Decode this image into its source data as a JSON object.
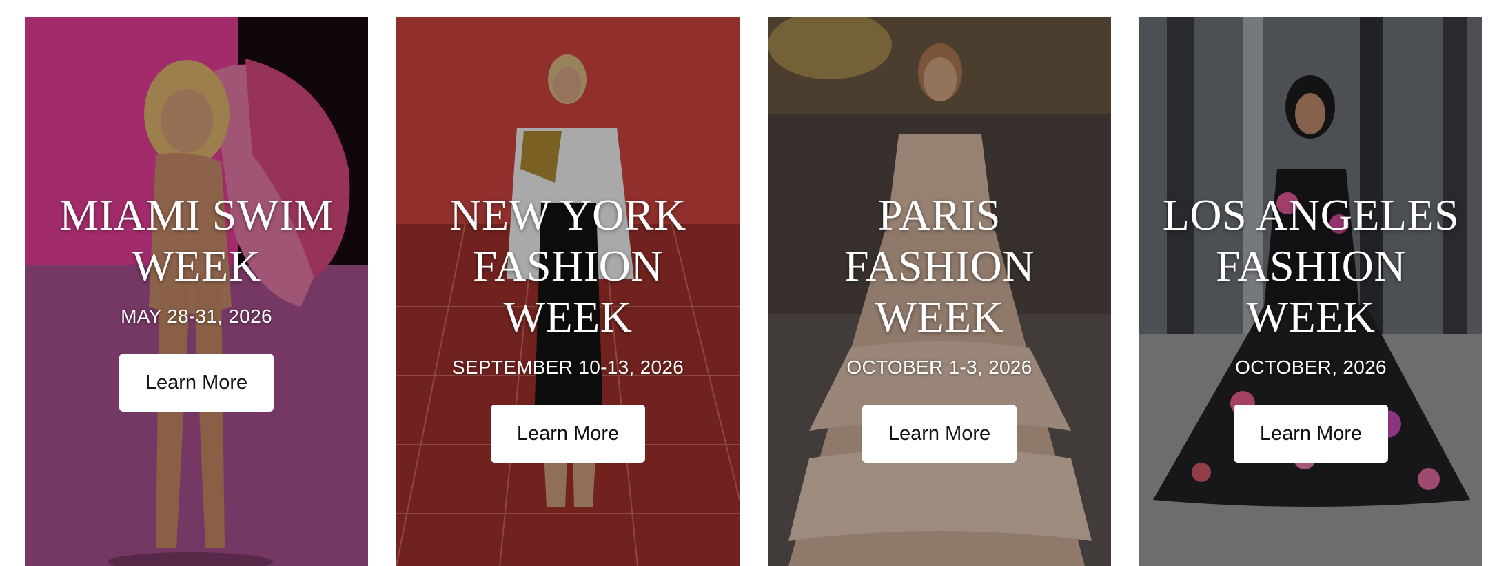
{
  "events": [
    {
      "title": "MIAMI SWIM WEEK",
      "date": "MAY 28-31, 2026",
      "cta_label": "Learn More",
      "photo_icon": "runway-model-photo",
      "accent": "#c0407f"
    },
    {
      "title": "NEW YORK FASHION WEEK",
      "date": "SEPTEMBER 10-13, 2026",
      "cta_label": "Learn More",
      "photo_icon": "runway-model-photo",
      "accent": "#b43a34"
    },
    {
      "title": "PARIS FASHION WEEK",
      "date": "OCTOBER 1-3, 2026",
      "cta_label": "Learn More",
      "photo_icon": "runway-model-photo",
      "accent": "#7a6a5e"
    },
    {
      "title": "LOS ANGELES FASHION WEEK",
      "date": "OCTOBER, 2026",
      "cta_label": "Learn More",
      "photo_icon": "runway-model-photo",
      "accent": "#6f7378"
    }
  ]
}
